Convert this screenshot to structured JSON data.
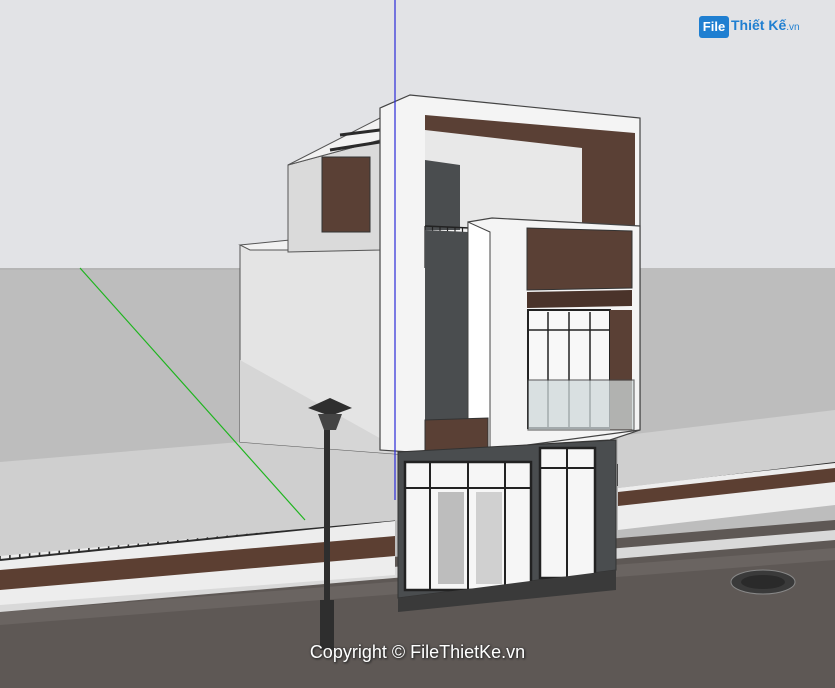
{
  "watermark": {
    "logo_file": "File",
    "logo_name": "Thiết Kế",
    "logo_tld": ".vn",
    "copyright": "Copyright © FileThietKe.vn"
  },
  "colors": {
    "sky": "#e2e3e6",
    "ground": "#bdbdbd",
    "wood": "#5a4035",
    "white_frame": "#f4f4f4",
    "dark_stone": "#4a4d4f",
    "road": "#5b5552",
    "axis_blue": "#2a2ad8",
    "axis_green": "#1fb51f"
  }
}
